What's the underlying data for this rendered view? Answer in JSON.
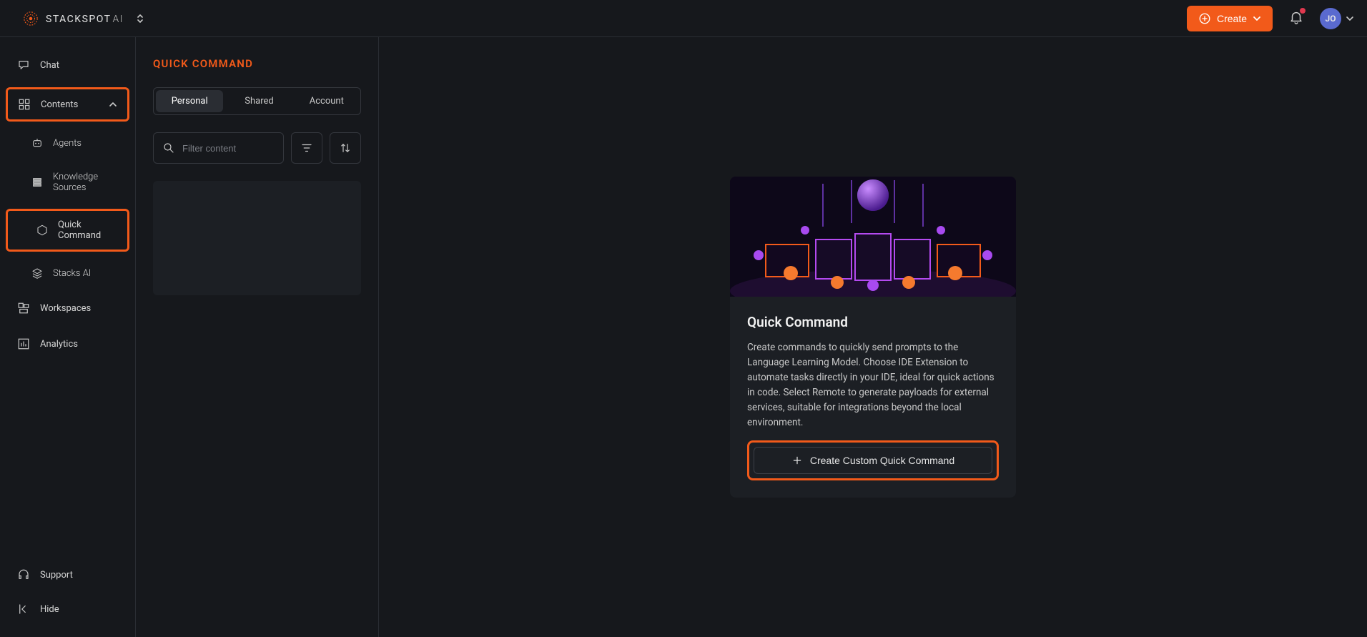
{
  "header": {
    "logo_text": "STACKSPOT",
    "logo_ai": "AI",
    "create_label": "Create",
    "avatar_initials": "JO"
  },
  "sidebar": {
    "items": [
      {
        "id": "chat",
        "label": "Chat"
      },
      {
        "id": "contents",
        "label": "Contents"
      },
      {
        "id": "agents",
        "label": "Agents"
      },
      {
        "id": "knowledge",
        "label": "Knowledge Sources"
      },
      {
        "id": "quick-command",
        "label": "Quick Command"
      },
      {
        "id": "stacks-ai",
        "label": "Stacks AI"
      },
      {
        "id": "workspaces",
        "label": "Workspaces"
      },
      {
        "id": "analytics",
        "label": "Analytics"
      }
    ],
    "support_label": "Support",
    "hide_label": "Hide"
  },
  "secondary": {
    "title": "QUICK COMMAND",
    "tabs": [
      {
        "id": "personal",
        "label": "Personal"
      },
      {
        "id": "shared",
        "label": "Shared"
      },
      {
        "id": "account",
        "label": "Account"
      }
    ],
    "search_placeholder": "Filter content"
  },
  "card": {
    "title": "Quick Command",
    "description": "Create commands to quickly send prompts to the Language Learning Model. Choose IDE Extension to automate tasks directly in your IDE, ideal for quick actions in code. Select Remote to generate payloads for external services, suitable for integrations beyond the local environment.",
    "button_label": "Create Custom Quick Command"
  },
  "colors": {
    "accent": "#f25a1a",
    "bg": "#16181c",
    "panel": "#1c1f24"
  }
}
